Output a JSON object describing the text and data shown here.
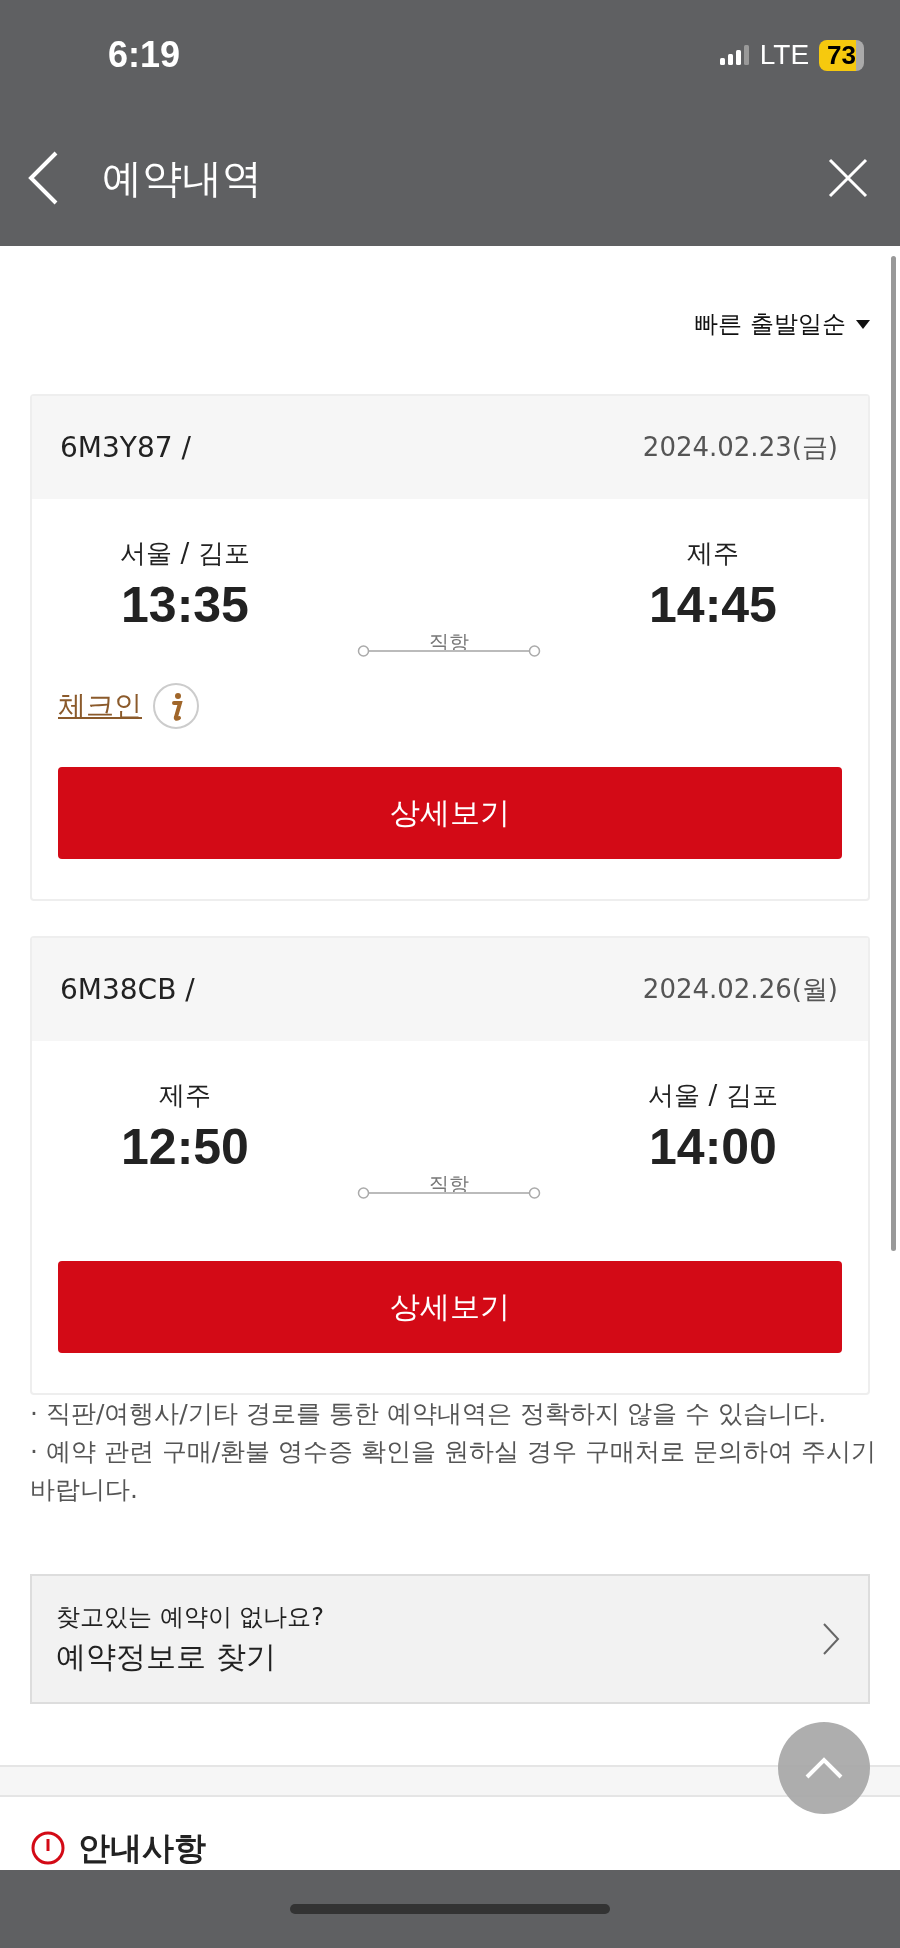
{
  "status_bar": {
    "time": "6:19",
    "network": "LTE",
    "battery": "73"
  },
  "header": {
    "title": "예약내역"
  },
  "sort": {
    "label": "빠른 출발일순"
  },
  "bookings": [
    {
      "code": "6M3Y87 /",
      "date": "2024.02.23(금)",
      "from_city": "서울 / 김포",
      "from_time": "13:35",
      "to_city": "제주",
      "to_time": "14:45",
      "route": "직항",
      "checkin": "체크인",
      "button": "상세보기"
    },
    {
      "code": "6M38CB /",
      "date": "2024.02.26(월)",
      "from_city": "제주",
      "from_time": "12:50",
      "to_city": "서울 / 김포",
      "to_time": "14:00",
      "route": "직항",
      "button": "상세보기"
    }
  ],
  "notes": [
    "· 직판/여행사/기타 경로를 통한 예약내역은 정확하지 않을 수 있습니다.",
    "· 예약 관련 구매/환불 영수증 확인을 원하실 경우 구매처로 문의하여 주시기 바랍니다."
  ],
  "find": {
    "question": "찾고있는 예약이 없나요?",
    "link": "예약정보로 찾기"
  },
  "notice": {
    "title": "안내사항"
  }
}
